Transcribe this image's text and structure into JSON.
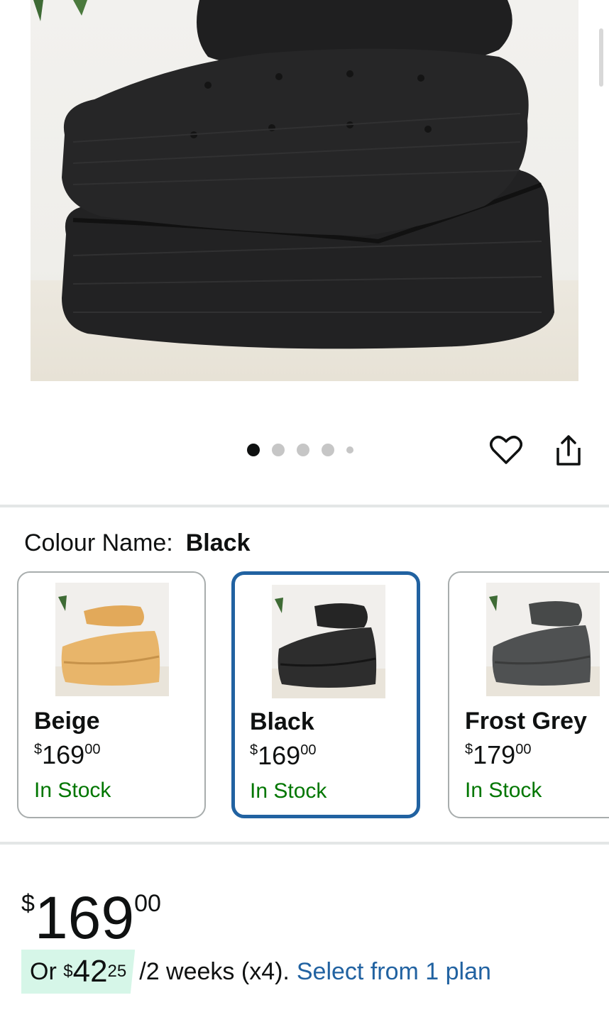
{
  "gallery": {
    "image_alt": "Black corduroy folding floor chair",
    "dot_count": 5,
    "active_index": 0
  },
  "actions": {
    "wishlist_icon": "heart-icon",
    "share_icon": "share-icon"
  },
  "variation": {
    "label": "Colour Name:",
    "selected_value": "Black",
    "options": [
      {
        "name": "Beige",
        "price_whole": "169",
        "price_fraction": "00",
        "currency": "$",
        "stock": "In Stock",
        "color": "#e8b56a",
        "selected": false
      },
      {
        "name": "Black",
        "price_whole": "169",
        "price_fraction": "00",
        "currency": "$",
        "stock": "In Stock",
        "color": "#2d2d2d",
        "selected": true
      },
      {
        "name": "Frost Grey",
        "price_whole": "179",
        "price_fraction": "00",
        "currency": "$",
        "stock": "In Stock",
        "color": "#4f5152",
        "selected": false
      }
    ]
  },
  "price": {
    "currency": "$",
    "whole": "169",
    "fraction": "00"
  },
  "installment": {
    "prefix": "Or",
    "currency": "$",
    "whole": "42",
    "fraction": "25",
    "terms": "/2 weeks (x4).",
    "link": "Select from 1 plan"
  },
  "colors": {
    "link": "#2162a1",
    "stock": "#007600",
    "selected_border": "#2162a1",
    "plan_badge": "#d6f6e8"
  }
}
